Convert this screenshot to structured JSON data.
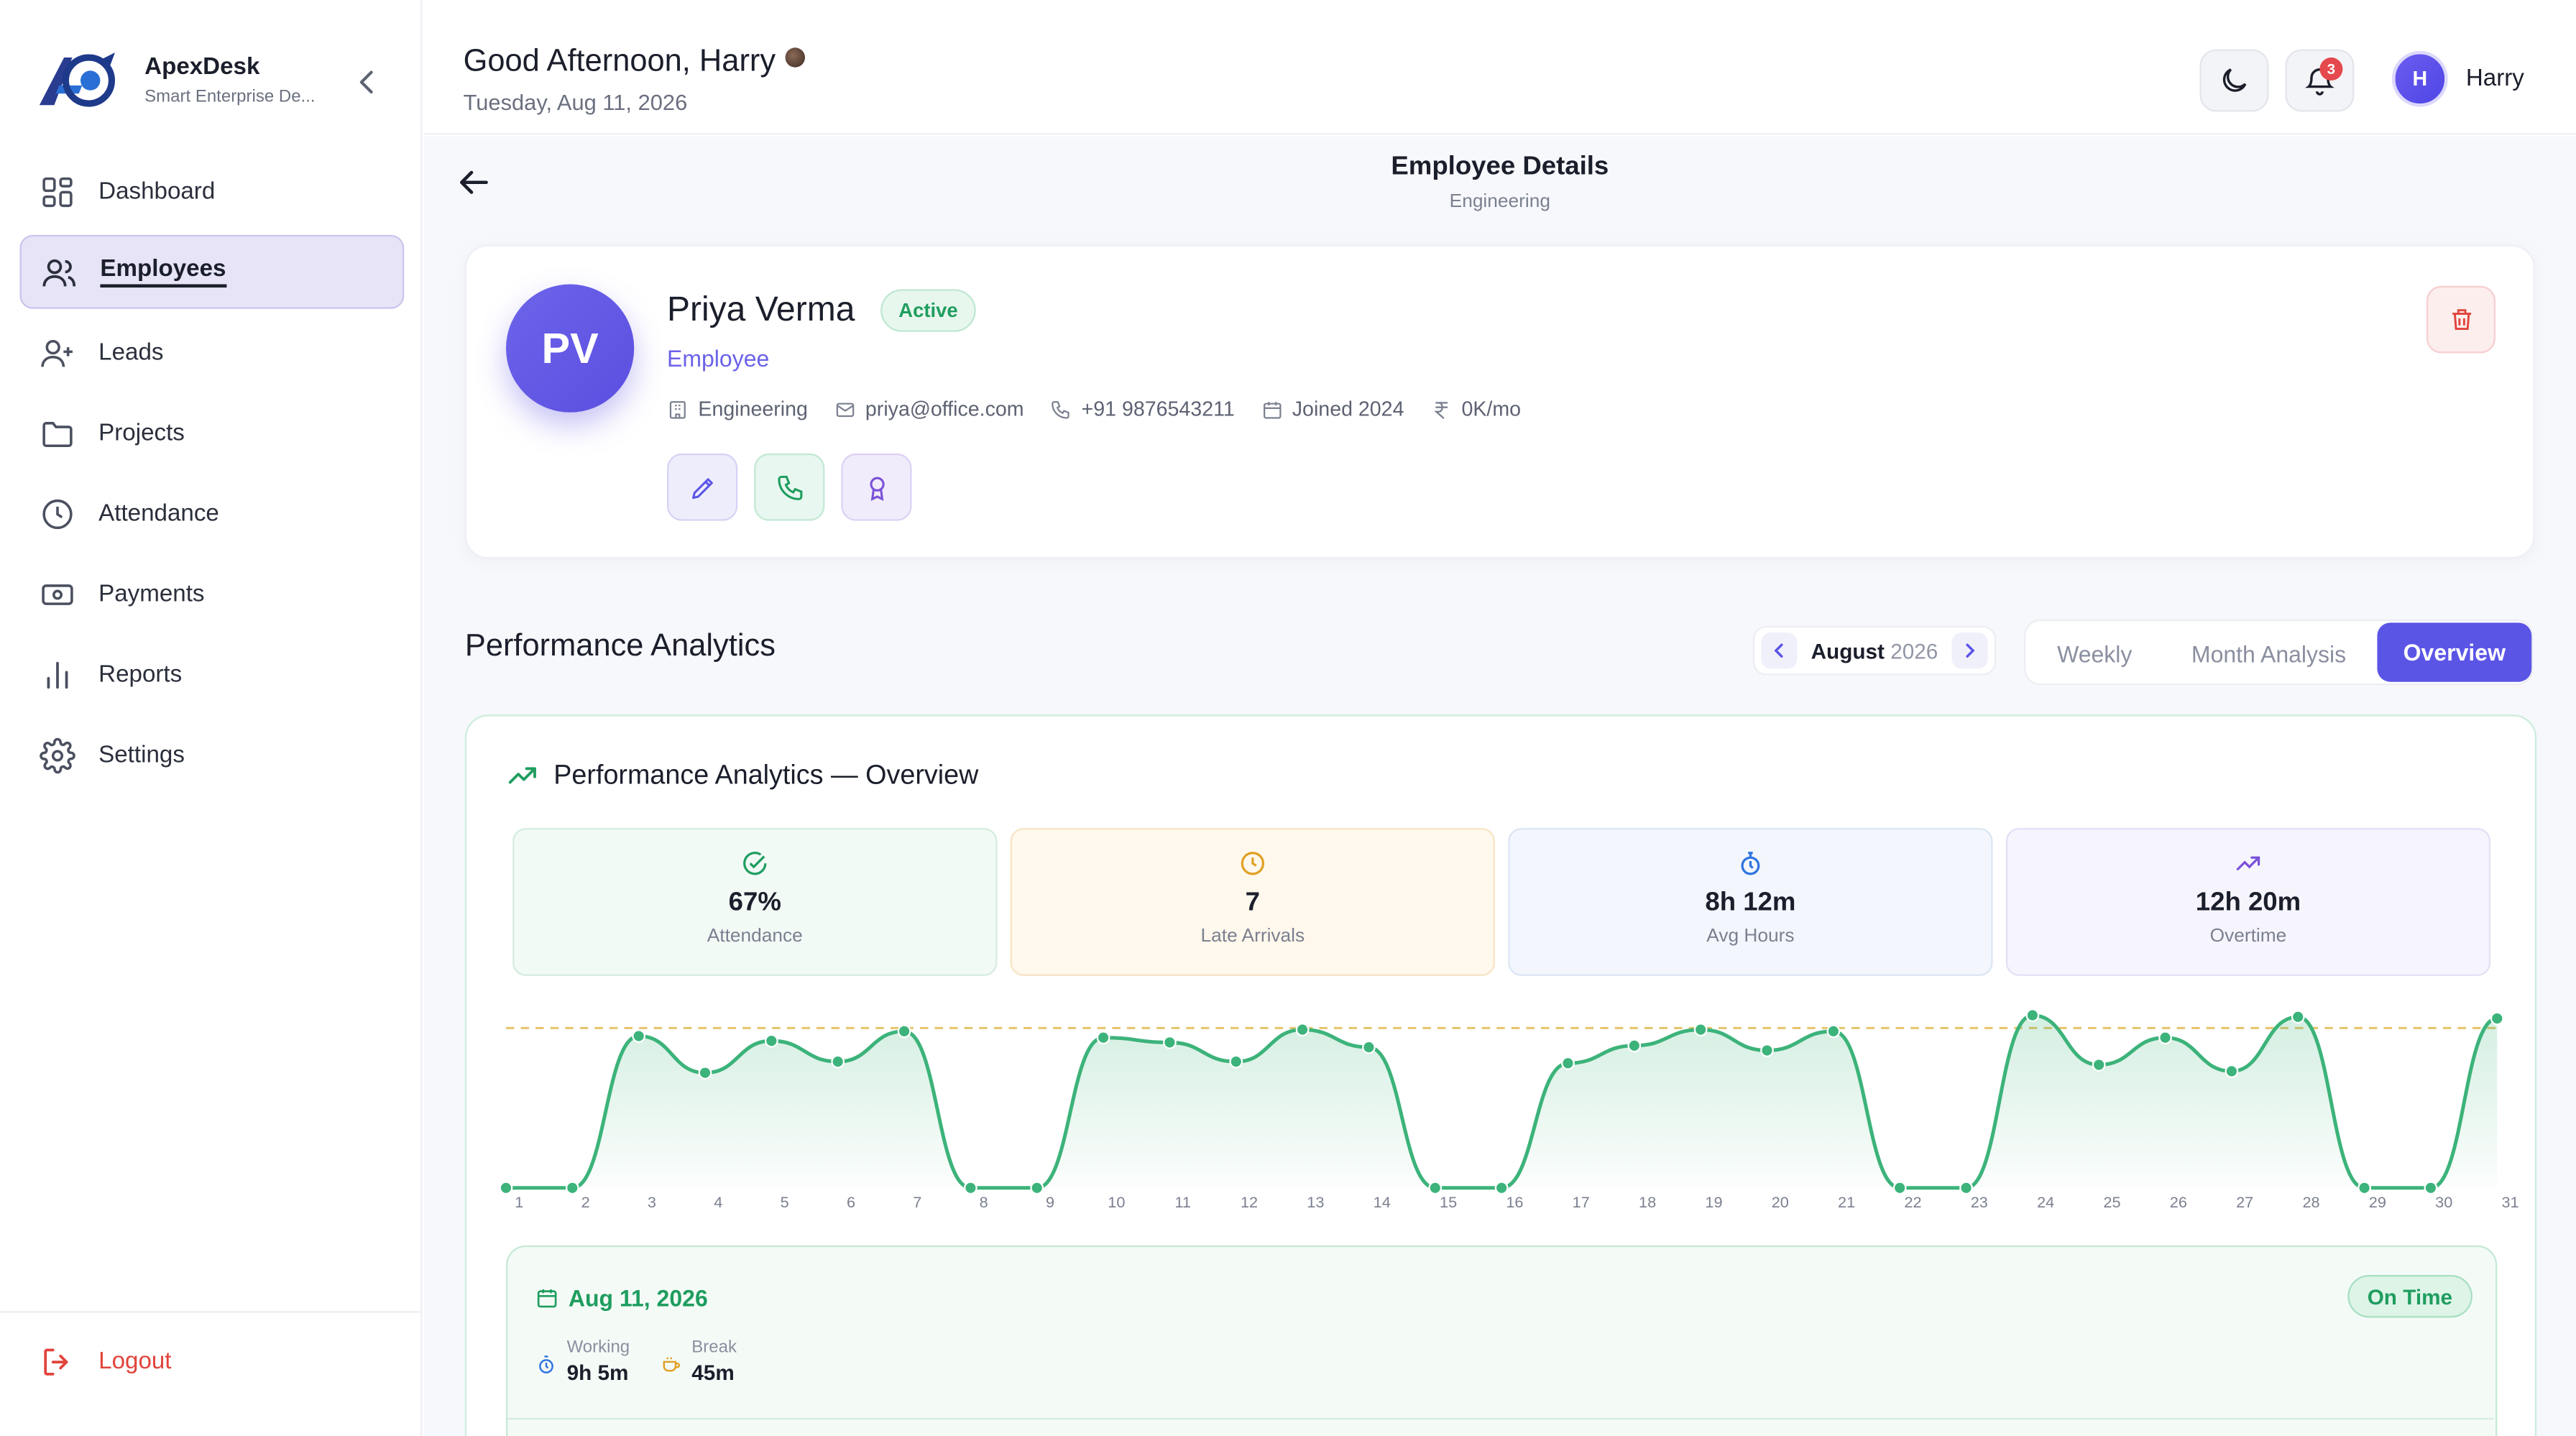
{
  "brand": {
    "name": "ApexDesk",
    "subtitle": "Smart Enterprise De..."
  },
  "sidebar": {
    "items": [
      {
        "label": "Dashboard",
        "icon": "dashboard-icon"
      },
      {
        "label": "Employees",
        "icon": "users-icon",
        "active": true
      },
      {
        "label": "Leads",
        "icon": "user-plus-icon"
      },
      {
        "label": "Projects",
        "icon": "folder-icon"
      },
      {
        "label": "Attendance",
        "icon": "clock-icon"
      },
      {
        "label": "Payments",
        "icon": "wallet-icon"
      },
      {
        "label": "Reports",
        "icon": "bar-chart-icon"
      },
      {
        "label": "Settings",
        "icon": "gear-icon"
      }
    ],
    "logout": "Logout"
  },
  "header": {
    "greeting": "Good Afternoon, Harry",
    "date": "Tuesday, Aug 11, 2026",
    "notification_count": "3",
    "user_initial": "H",
    "user_name": "Harry"
  },
  "page": {
    "title": "Employee Details",
    "subtitle": "Engineering"
  },
  "employee": {
    "initials": "PV",
    "name": "Priya Verma",
    "status": "Active",
    "role": "Employee",
    "department": "Engineering",
    "email": "priya@office.com",
    "phone": "+91 9876543211",
    "joined": "Joined 2024",
    "salary": "0K/mo"
  },
  "performance": {
    "heading": "Performance Analytics",
    "month": "August",
    "year": "2026",
    "tabs": [
      "Weekly",
      "Month Analysis",
      "Overview"
    ],
    "active_tab": "Overview",
    "card_title": "Performance Analytics — Overview",
    "stats": [
      {
        "value": "67%",
        "label": "Attendance",
        "icon": "check-circle-icon"
      },
      {
        "value": "7",
        "label": "Late Arrivals",
        "icon": "clock-icon"
      },
      {
        "value": "8h 12m",
        "label": "Avg Hours",
        "icon": "stopwatch-icon"
      },
      {
        "value": "12h 20m",
        "label": "Overtime",
        "icon": "trend-up-icon"
      }
    ]
  },
  "chart_data": {
    "type": "area",
    "x": [
      1,
      2,
      3,
      4,
      5,
      6,
      7,
      8,
      9,
      10,
      11,
      12,
      13,
      14,
      15,
      16,
      17,
      18,
      19,
      20,
      21,
      22,
      23,
      24,
      25,
      26,
      27,
      28,
      29,
      30,
      31
    ],
    "series": [
      {
        "values": [
          0,
          0,
          9.5,
          7.2,
          9.2,
          7.9,
          9.8,
          0,
          0,
          9.4,
          9.1,
          7.9,
          9.9,
          8.8,
          0,
          0,
          7.8,
          8.9,
          9.9,
          8.6,
          9.8,
          0,
          0,
          10.8,
          7.7,
          9.4,
          7.3,
          10.7,
          0,
          0,
          10.6
        ]
      }
    ],
    "target_line": 10,
    "colors": {
      "line": "#3cb37a",
      "target": "#e6c46a"
    }
  },
  "day_detail": {
    "date": "Aug 11, 2026",
    "status": "On Time",
    "working_label": "Working",
    "working_value": "9h 5m",
    "break_label": "Break",
    "break_value": "45m"
  }
}
